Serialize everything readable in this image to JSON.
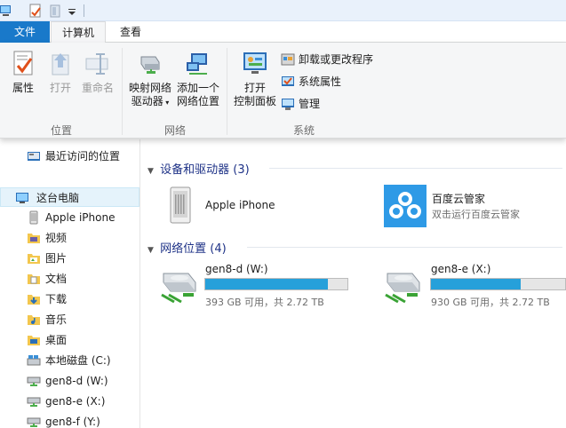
{
  "menu_tabs": {
    "file": "文件",
    "computer": "计算机",
    "view": "查看"
  },
  "ribbon": {
    "location_group": {
      "label": "位置",
      "properties": "属性",
      "open": "打开",
      "rename": "重命名"
    },
    "network_group": {
      "label": "网络",
      "map_drive_line1": "映射网络",
      "map_drive_line2": "驱动器",
      "add_location_line1": "添加一个",
      "add_location_line2": "网络位置"
    },
    "system_group": {
      "label": "系统",
      "control_panel_line1": "打开",
      "control_panel_line2": "控制面板",
      "uninstall": "卸载或更改程序",
      "system_properties": "系统属性",
      "manage": "管理"
    }
  },
  "nav": {
    "recent": "最近访问的位置",
    "this_pc": "这台电脑",
    "items": [
      "Apple iPhone",
      "视频",
      "图片",
      "文档",
      "下载",
      "音乐",
      "桌面",
      "本地磁盘 (C:)",
      "gen8-d (W:)",
      "gen8-e (X:)",
      "gen8-f (Y:)"
    ]
  },
  "content": {
    "devices_header": "设备和驱动器 (3)",
    "network_header": "网络位置 (4)",
    "iphone_name": "Apple iPhone",
    "baidu_name": "百度云管家",
    "baidu_sub": "双击运行百度云管家",
    "drives": [
      {
        "name": "gen8-d (W:)",
        "info": "393 GB 可用，共 2.72 TB",
        "used_fraction": 0.86
      },
      {
        "name": "gen8-e (X:)",
        "info": "930 GB 可用，共 2.72 TB",
        "used_fraction": 0.67
      }
    ]
  },
  "colors": {
    "accent": "#1979ca",
    "bar_fill": "#26a0da",
    "header_text": "#1e3287"
  }
}
